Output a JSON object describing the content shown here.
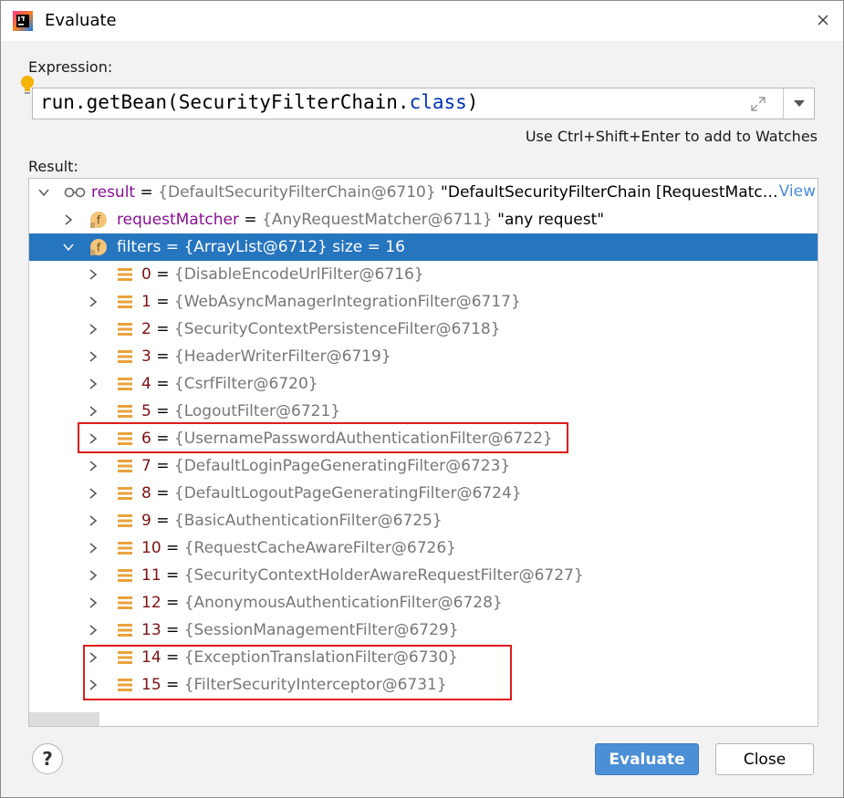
{
  "window": {
    "title": "Evaluate",
    "close_glyph": "✕"
  },
  "expression": {
    "label": "Expression:",
    "code_prefix": "run.getBean(SecurityFilterChain.",
    "code_keyword": "class",
    "code_suffix": ")",
    "hint": "Use Ctrl+Shift+Enter to add to Watches"
  },
  "result": {
    "label": "Result:",
    "root": {
      "name": "result",
      "eq": " = ",
      "type": "{DefaultSecurityFilterChain@6710}",
      "value": " \"DefaultSecurityFilterChain [RequestMatc…",
      "view_link": "View",
      "icon": "watch-glasses-icon"
    },
    "request_matcher": {
      "name": "requestMatcher",
      "eq": " = ",
      "type": "{AnyRequestMatcher@6711}",
      "value": " \"any request\"",
      "icon": "field-icon"
    },
    "filters": {
      "name": "filters",
      "eq": " = ",
      "type": "{ArrayList@6712}",
      "value": "  size = 16",
      "icon": "field-icon"
    },
    "items": [
      {
        "index": "0",
        "eq": " = ",
        "type": "{DisableEncodeUrlFilter@6716}"
      },
      {
        "index": "1",
        "eq": " = ",
        "type": "{WebAsyncManagerIntegrationFilter@6717}"
      },
      {
        "index": "2",
        "eq": " = ",
        "type": "{SecurityContextPersistenceFilter@6718}"
      },
      {
        "index": "3",
        "eq": " = ",
        "type": "{HeaderWriterFilter@6719}"
      },
      {
        "index": "4",
        "eq": " = ",
        "type": "{CsrfFilter@6720}"
      },
      {
        "index": "5",
        "eq": " = ",
        "type": "{LogoutFilter@6721}"
      },
      {
        "index": "6",
        "eq": " = ",
        "type": "{UsernamePasswordAuthenticationFilter@6722}"
      },
      {
        "index": "7",
        "eq": " = ",
        "type": "{DefaultLoginPageGeneratingFilter@6723}"
      },
      {
        "index": "8",
        "eq": " = ",
        "type": "{DefaultLogoutPageGeneratingFilter@6724}"
      },
      {
        "index": "9",
        "eq": " = ",
        "type": "{BasicAuthenticationFilter@6725}"
      },
      {
        "index": "10",
        "eq": " = ",
        "type": "{RequestCacheAwareFilter@6726}"
      },
      {
        "index": "11",
        "eq": " = ",
        "type": "{SecurityContextHolderAwareRequestFilter@6727}"
      },
      {
        "index": "12",
        "eq": " = ",
        "type": "{AnonymousAuthenticationFilter@6728}"
      },
      {
        "index": "13",
        "eq": " = ",
        "type": "{SessionManagementFilter@6729}"
      },
      {
        "index": "14",
        "eq": " = ",
        "type": "{ExceptionTranslationFilter@6730}"
      },
      {
        "index": "15",
        "eq": " = ",
        "type": "{FilterSecurityInterceptor@6731}"
      }
    ]
  },
  "buttons": {
    "help": "?",
    "evaluate": "Evaluate",
    "close": "Close"
  },
  "colors": {
    "selection": "#2675bf",
    "highlight_box": "#e01b1b",
    "primary_button": "#4b8fd6",
    "keyword": "#0033b3",
    "index_color": "#7a1212",
    "field_name": "#871094"
  }
}
